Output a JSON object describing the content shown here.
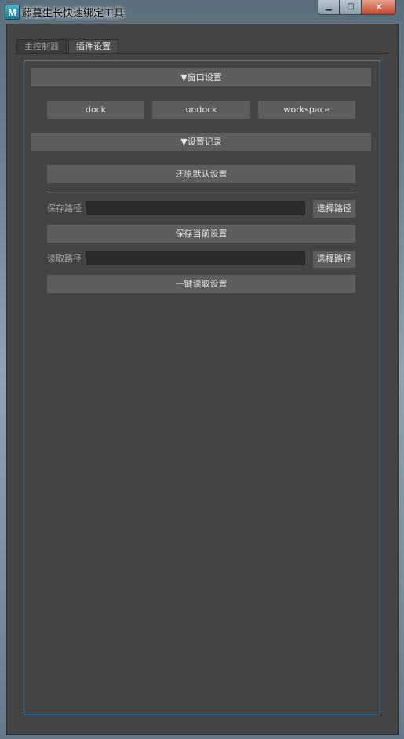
{
  "window": {
    "title": "藤蔓生长快速绑定工具",
    "app_icon_letter": "M",
    "controls": {
      "minimize": "▁",
      "maximize": "□",
      "close": "✕"
    }
  },
  "tabs": [
    {
      "label": "主控制器",
      "active": false
    },
    {
      "label": "插件设置",
      "active": true
    }
  ],
  "window_settings": {
    "header": "▼窗口设置",
    "buttons": [
      "dock",
      "undock",
      "workspace"
    ]
  },
  "settings_record": {
    "header": "▼设置记录",
    "restore_default_label": "还原默认设置",
    "save_path_label": "保存路径",
    "save_path_value": "",
    "save_browse_label": "选择路径",
    "save_current_label": "保存当前设置",
    "load_path_label": "读取路径",
    "load_path_value": "",
    "load_browse_label": "选择路径",
    "one_click_load_label": "一键读取设置"
  },
  "colors": {
    "panel_bg": "#444444",
    "button_bg": "#5d5d5d",
    "panel_border": "#3e7fb0"
  }
}
